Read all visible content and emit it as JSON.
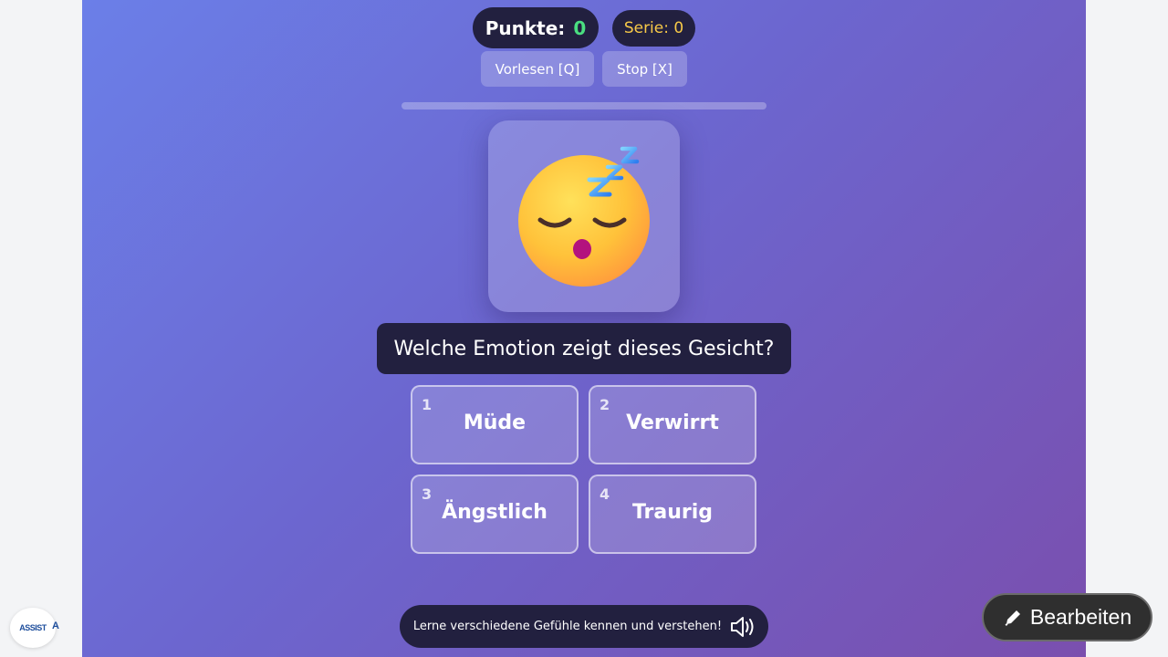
{
  "score": {
    "label": "Punkte:",
    "value": "0"
  },
  "streak": {
    "label": "Serie: 0"
  },
  "controls": {
    "read_aloud": "Vorlesen [Q]",
    "stop": "Stop [X]"
  },
  "progress": {
    "fraction": 0
  },
  "emoji": {
    "icon": "sleeping-face-icon"
  },
  "question": "Welche Emotion zeigt dieses Gesicht?",
  "answers": [
    {
      "key": "1",
      "label": "Müde"
    },
    {
      "key": "2",
      "label": "Verwirrt"
    },
    {
      "key": "3",
      "label": "Ängstlich"
    },
    {
      "key": "4",
      "label": "Traurig"
    }
  ],
  "footer": {
    "text": "Lerne verschiedene Gefühle kennen und verstehen!",
    "icon": "speaker-icon"
  },
  "logo": {
    "text": "ASSIST",
    "tail": "A"
  },
  "edit_button": {
    "label": "Bearbeiten",
    "icon": "pencil-icon"
  },
  "colors": {
    "score_value": "#4ade80",
    "streak": "#f7c948",
    "panel": "#22203f"
  }
}
